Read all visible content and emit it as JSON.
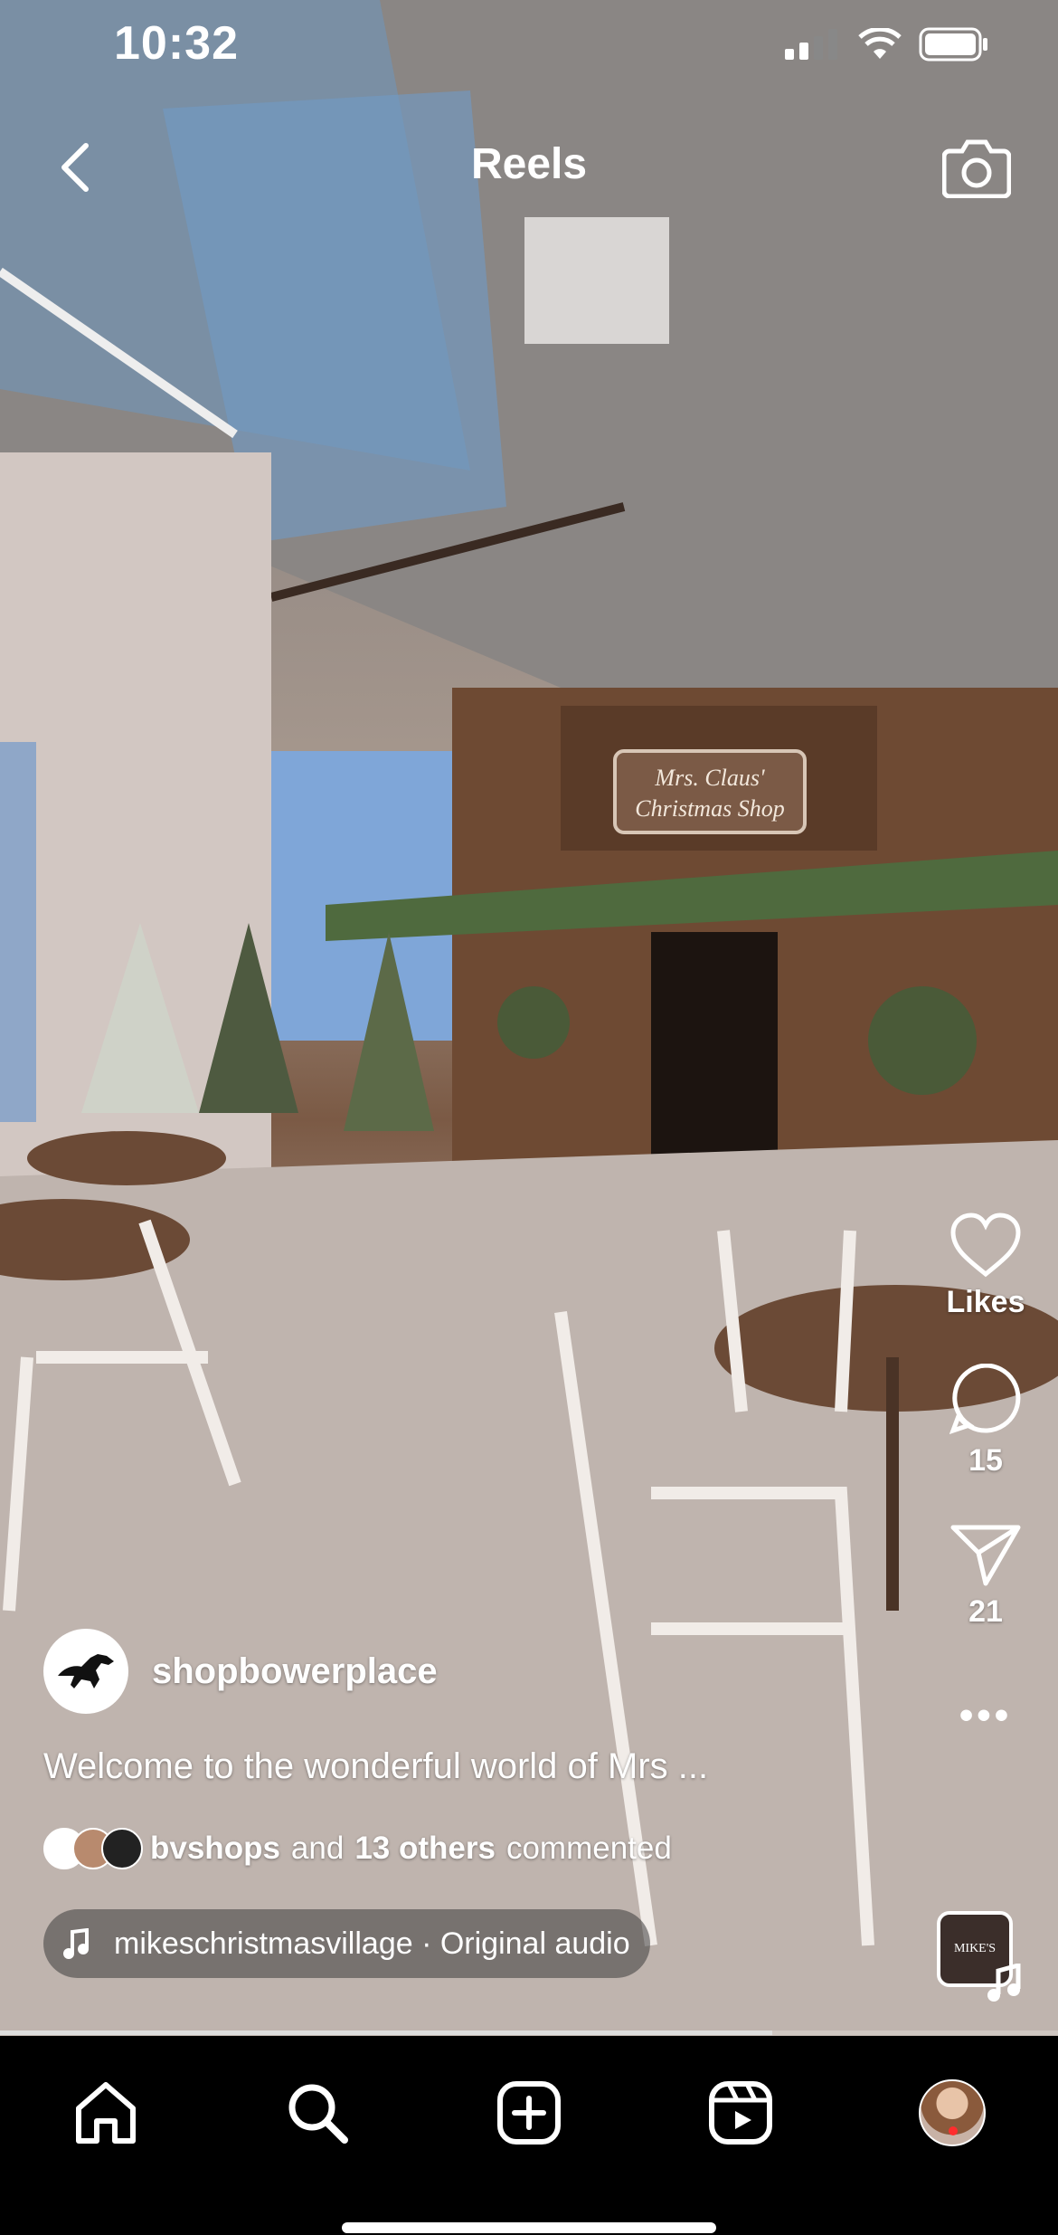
{
  "status_bar": {
    "time": "10:32"
  },
  "header": {
    "title": "Reels"
  },
  "scene": {
    "sign_line1": "Mrs. Claus'",
    "sign_line2": "Christmas Shop"
  },
  "actions": {
    "likes_label": "Likes",
    "comments_count": "15",
    "shares_count": "21",
    "more": "•••"
  },
  "post": {
    "username": "shopbowerplace",
    "caption": "Welcome to the wonderful world of Mrs ...",
    "commenters_lead": "bvshops",
    "commenters_and": "and",
    "commenters_others": "13 others",
    "commenters_tail": "commented"
  },
  "audio": {
    "label": "mikeschristmasvillage · Original audio",
    "thumb_text": "MIKE'S"
  },
  "progress": {
    "fraction": 0.73
  },
  "colors": {
    "accent_red": "#ff2d2d",
    "bar_bg": "#000000"
  }
}
